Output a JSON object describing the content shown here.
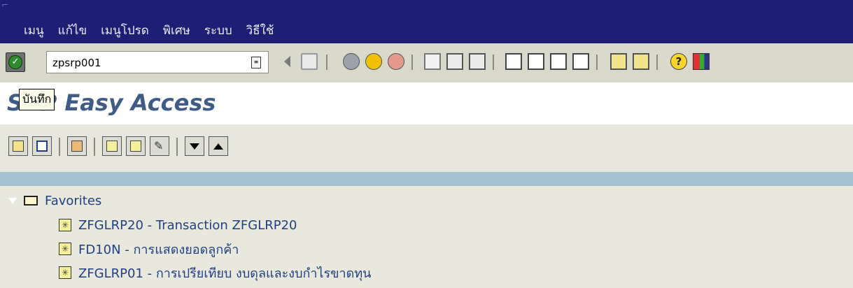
{
  "menu": {
    "items": [
      "เมนู",
      "แก้ไข",
      "เมนูโปรด",
      "พิเศษ",
      "ระบบ",
      "วิธีใช้"
    ]
  },
  "command_field": {
    "value": "zpsrp001"
  },
  "title": {
    "text": "SAP Easy Access"
  },
  "tooltip": {
    "text": "บันทึก"
  },
  "tree": {
    "root_label": "Favorites",
    "items": [
      {
        "label": "ZFGLRP20 - Transaction ZFGLRP20"
      },
      {
        "label": "FD10N - การแสดงยอดลูกค้า"
      },
      {
        "label": "ZFGLRP01 - การเปรียเทียบ งบดุลและงบกำไรขาดทุน"
      }
    ]
  },
  "colors": {
    "menubar": "#1c1f73",
    "toolbar": "#d8d8cb",
    "title": "#3f5c86",
    "tree_text": "#1f3f86"
  }
}
